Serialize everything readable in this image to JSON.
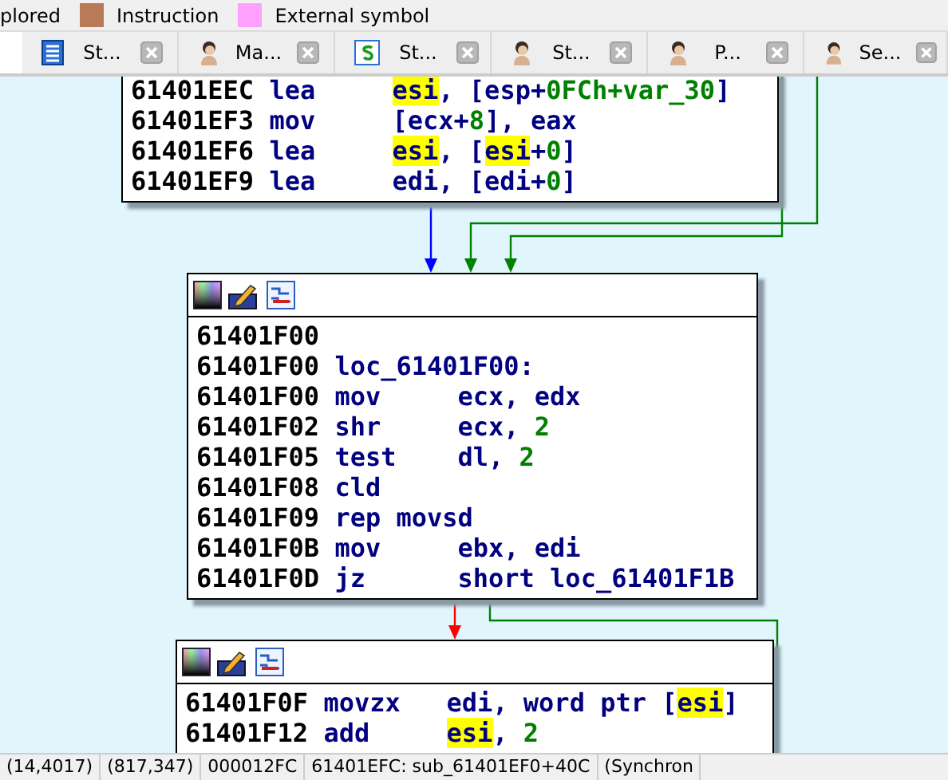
{
  "legend": [
    {
      "label": "plored"
    },
    {
      "label": "Instruction",
      "color": "#b97a57"
    },
    {
      "label": "External symbol",
      "color": "#ffa0ff"
    }
  ],
  "tabs": [
    {
      "label": "St...",
      "kind": "structures"
    },
    {
      "label": "Ma...",
      "kind": "person"
    },
    {
      "label": "St...",
      "kind": "strings"
    },
    {
      "label": "St...",
      "kind": "person"
    },
    {
      "label": "P...",
      "kind": "person"
    },
    {
      "label": "Se...",
      "kind": "person"
    }
  ],
  "graph": {
    "blocks": [
      {
        "toolbar": false,
        "lines": [
          {
            "address": "61401EEC",
            "mnemonic": "lea",
            "operands": [
              {
                "text": "esi",
                "kind": "highlight"
              },
              {
                "text": ", [esp+",
                "kind": "plain"
              },
              {
                "text": "0FCh+var_30",
                "kind": "number"
              },
              {
                "text": "]",
                "kind": "plain"
              }
            ]
          },
          {
            "address": "61401EF3",
            "mnemonic": "mov",
            "operands": [
              {
                "text": "[ecx+",
                "kind": "plain"
              },
              {
                "text": "8",
                "kind": "number"
              },
              {
                "text": "], eax",
                "kind": "plain"
              }
            ]
          },
          {
            "address": "61401EF6",
            "mnemonic": "lea",
            "operands": [
              {
                "text": "esi",
                "kind": "highlight"
              },
              {
                "text": ", [",
                "kind": "plain"
              },
              {
                "text": "esi",
                "kind": "highlight"
              },
              {
                "text": "+",
                "kind": "plain"
              },
              {
                "text": "0",
                "kind": "number"
              },
              {
                "text": "]",
                "kind": "plain"
              }
            ]
          },
          {
            "address": "61401EF9",
            "mnemonic": "lea",
            "operands": [
              {
                "text": "edi, [edi+",
                "kind": "plain"
              },
              {
                "text": "0",
                "kind": "number"
              },
              {
                "text": "]",
                "kind": "plain"
              }
            ]
          }
        ]
      },
      {
        "toolbar": true,
        "lines": [
          {
            "address": "61401F00"
          },
          {
            "address": "61401F00",
            "label": "loc_61401F00:"
          },
          {
            "address": "61401F00",
            "mnemonic": "mov",
            "operands": [
              {
                "text": "ecx, edx",
                "kind": "plain"
              }
            ]
          },
          {
            "address": "61401F02",
            "mnemonic": "shr",
            "operands": [
              {
                "text": "ecx, ",
                "kind": "plain"
              },
              {
                "text": "2",
                "kind": "number"
              }
            ]
          },
          {
            "address": "61401F05",
            "mnemonic": "test",
            "operands": [
              {
                "text": "dl, ",
                "kind": "plain"
              },
              {
                "text": "2",
                "kind": "number"
              }
            ]
          },
          {
            "address": "61401F08",
            "mnemonic": "cld"
          },
          {
            "address": "61401F09",
            "mnemonic": "rep movsd"
          },
          {
            "address": "61401F0B",
            "mnemonic": "mov",
            "operands": [
              {
                "text": "ebx, edi",
                "kind": "plain"
              }
            ]
          },
          {
            "address": "61401F0D",
            "mnemonic": "jz",
            "operands": [
              {
                "text": "short loc_61401F1B",
                "kind": "plain"
              }
            ]
          }
        ]
      },
      {
        "toolbar": true,
        "lines": [
          {
            "address": "61401F0F",
            "mnemonic": "movzx",
            "operands": [
              {
                "text": "edi, word ptr [",
                "kind": "plain"
              },
              {
                "text": "esi",
                "kind": "highlight"
              },
              {
                "text": "]",
                "kind": "plain"
              }
            ]
          },
          {
            "address": "61401F12",
            "mnemonic": "add",
            "operands": [
              {
                "text": "esi",
                "kind": "highlight"
              },
              {
                "text": ", ",
                "kind": "plain"
              },
              {
                "text": "2",
                "kind": "number"
              }
            ]
          }
        ]
      }
    ]
  },
  "status_bar": [
    "(14,4017)",
    "(817,347)",
    "000012FC",
    "61401EFC: sub_61401EF0+40C",
    "(Synchron"
  ]
}
